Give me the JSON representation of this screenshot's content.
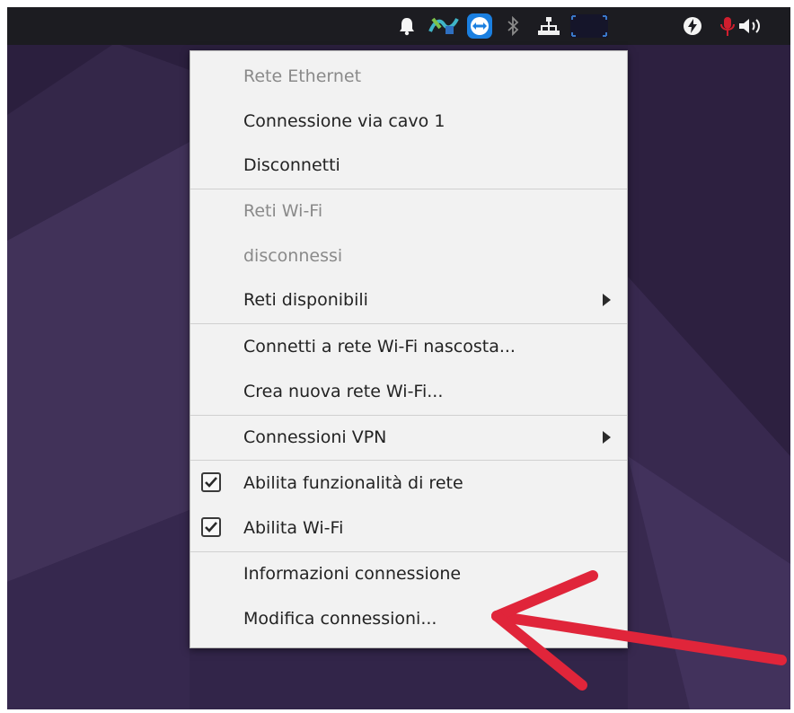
{
  "tray": {
    "icons": [
      "bell-icon",
      "network-app-icon",
      "teamviewer-icon",
      "bluetooth-icon",
      "wired-network-icon",
      "window-indicator-icon",
      "power-icon",
      "microphone-muted-icon",
      "volume-icon"
    ]
  },
  "menu": {
    "ethernet_header": "Rete Ethernet",
    "wired_connection": "Connessione via cavo 1",
    "disconnect": "Disconnetti",
    "wifi_header": "Reti Wi-Fi",
    "wifi_status": "disconnessi",
    "available_networks": "Reti disponibili",
    "connect_hidden": "Connetti a rete Wi-Fi nascosta...",
    "create_new": "Crea nuova rete Wi-Fi...",
    "vpn_connections": "Connessioni VPN",
    "enable_networking": "Abilita funzionalità di rete",
    "enable_networking_checked": true,
    "enable_wifi": "Abilita Wi-Fi",
    "enable_wifi_checked": true,
    "connection_info": "Informazioni connessione",
    "edit_connections": "Modifica connessioni..."
  },
  "colors": {
    "annotation_arrow": "#e0253a",
    "menu_background": "#f2f2f2",
    "topbar": "#1c1c21",
    "desktop": "#2a1f3d"
  }
}
